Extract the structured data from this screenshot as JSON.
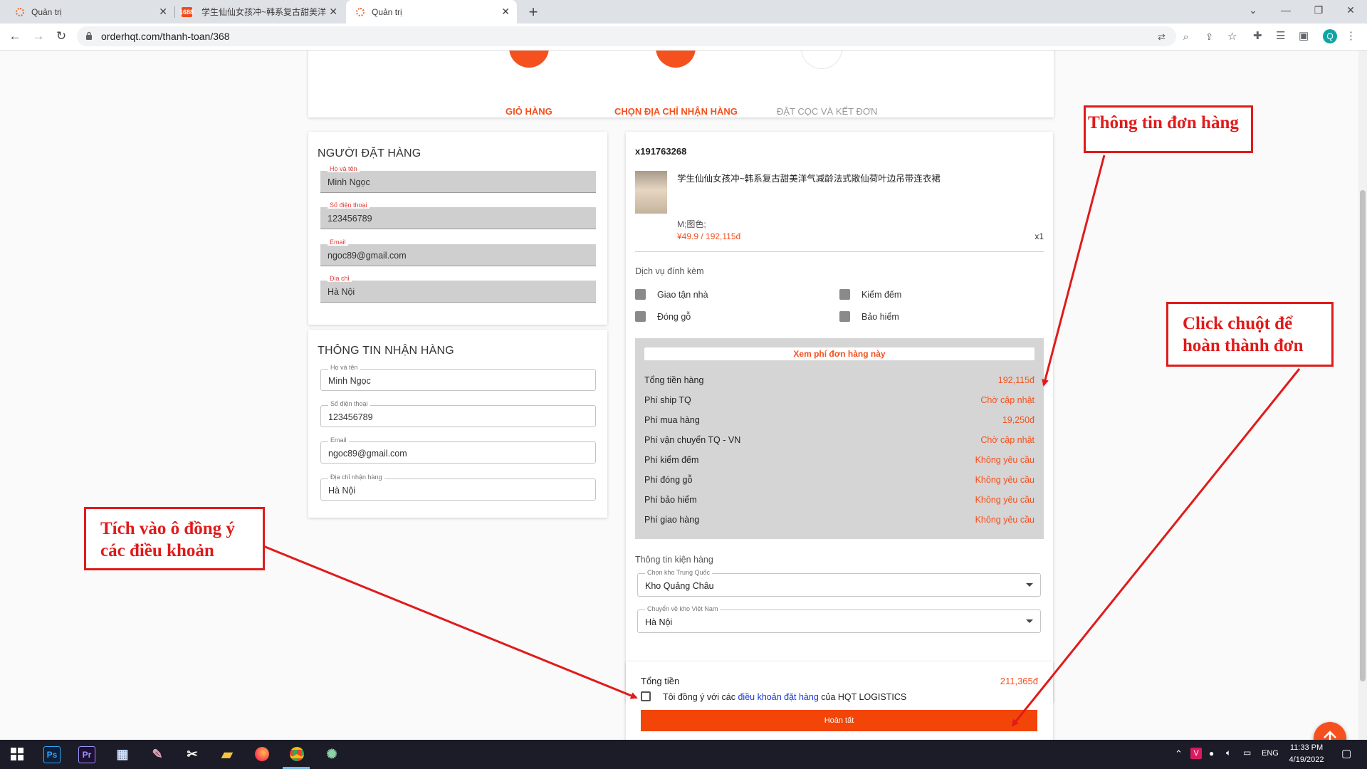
{
  "browser": {
    "tabs": [
      {
        "title": "Quản trị",
        "favicon": "dotted-circle-icon",
        "active": false
      },
      {
        "title": "学生仙仙女孩冲~韩系复古甜美洋",
        "favicon": "1688-icon",
        "active": false
      },
      {
        "title": "Quản trị",
        "favicon": "dotted-circle-icon",
        "active": true
      }
    ],
    "url": "orderhqt.com/thanh-toan/368",
    "profile_initial": "Q"
  },
  "steps": [
    {
      "label": "GIỎ HÀNG",
      "state": "done"
    },
    {
      "label": "CHỌN ĐỊA CHỈ NHẬN HÀNG",
      "state": "current"
    },
    {
      "label": "ĐẶT CỌC VÀ KẾT ĐƠN",
      "state": "pending"
    }
  ],
  "orderer": {
    "title": "NGƯỜI ĐẶT HÀNG",
    "fields": [
      {
        "label": "Họ và tên",
        "value": "Minh Ngọc"
      },
      {
        "label": "Số điện thoại",
        "value": "123456789"
      },
      {
        "label": "Email",
        "value": "ngoc89@gmail.com"
      },
      {
        "label": "Địa chỉ",
        "value": "Hà Nội"
      }
    ]
  },
  "receiver": {
    "title": "THÔNG TIN NHẬN HÀNG",
    "fields": [
      {
        "label": "Họ và tên",
        "value": "Minh Ngọc"
      },
      {
        "label": "Số điện thoại",
        "value": "123456789"
      },
      {
        "label": "Email",
        "value": "ngoc89@gmail.com"
      },
      {
        "label": "Địa chỉ nhận hàng",
        "value": "Hà Nội"
      }
    ]
  },
  "order": {
    "shop_id": "x191763268",
    "product_name": "学生仙仙女孩冲~韩系复古甜美洋气减龄法式敞仙荷叶边吊带连衣裙",
    "variant": "M;图色;",
    "price": "¥49.9 / 192,115đ",
    "quantity": "x1",
    "services_title": "Dịch vụ đính kèm",
    "services": [
      "Giao tận nhà",
      "Kiểm đếm",
      "Đóng gỗ",
      "Bảo hiểm"
    ],
    "fees_button": "Xem phí đơn hàng này",
    "fees": [
      {
        "label": "Tổng tiền hàng",
        "value": "192,115đ"
      },
      {
        "label": "Phí ship TQ",
        "value": "Chờ cập nhật"
      },
      {
        "label": "Phí mua hàng",
        "value": "19,250đ"
      },
      {
        "label": "Phí vận chuyển TQ - VN",
        "value": "Chờ cập nhật"
      },
      {
        "label": "Phí kiểm đếm",
        "value": "Không yêu cầu"
      },
      {
        "label": "Phí đóng gỗ",
        "value": "Không yêu cầu"
      },
      {
        "label": "Phí bảo hiểm",
        "value": "Không yêu cầu"
      },
      {
        "label": "Phí giao hàng",
        "value": "Không yêu cầu"
      }
    ],
    "package_title": "Thông tin kiện hàng",
    "cn_warehouse": {
      "label": "Chọn kho Trung Quốc",
      "value": "Kho Quảng Châu"
    },
    "vn_warehouse": {
      "label": "Chuyển về kho Việt Nam",
      "value": "Hà Nội"
    }
  },
  "summary": {
    "total_label": "Tổng tiền",
    "total_value": "211,365đ",
    "agree_prefix": "Tôi đồng ý với các",
    "agree_link": "điều khoản đặt hàng",
    "agree_suffix": "của HQT LOGISTICS",
    "submit_label": "Hoàn tất"
  },
  "annotations": {
    "order_info": "Thông tin đơn hàng",
    "click_line1": "Click chuột để",
    "click_line2": "hoàn thành đơn",
    "tick_line1": "Tích vào ô đồng ý",
    "tick_line2": "các điều khoản"
  },
  "taskbar": {
    "lang": "ENG",
    "time": "11:33 PM",
    "date": "4/19/2022"
  },
  "colors": {
    "accent": "#f4511e",
    "annotation": "#e01b1b",
    "link": "#1a3bd6"
  }
}
